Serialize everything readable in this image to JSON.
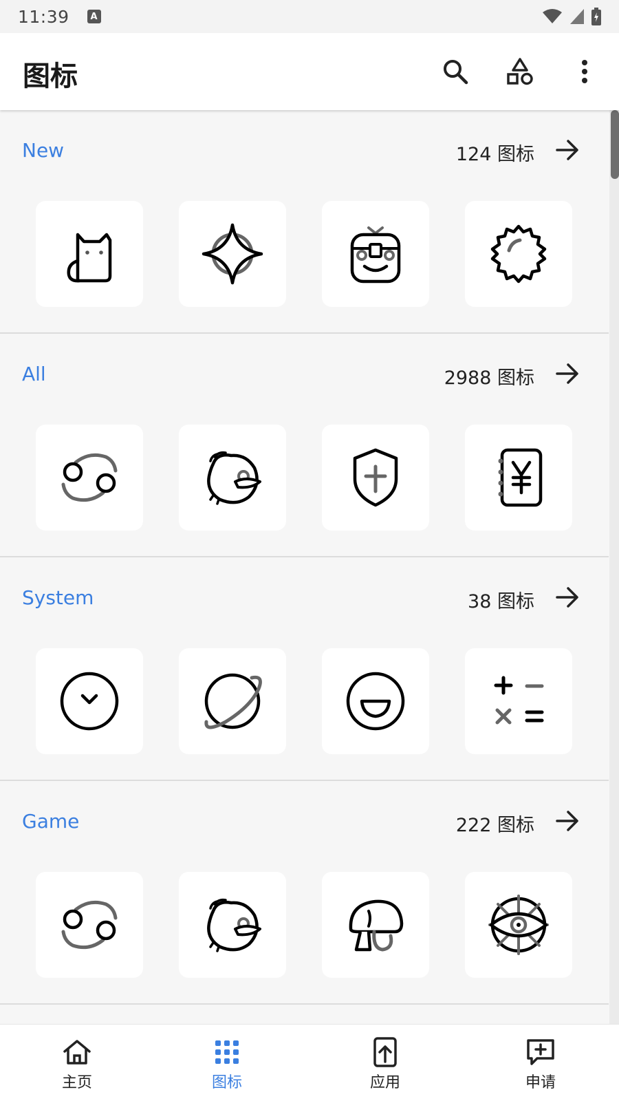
{
  "status_bar": {
    "time": "11:39",
    "badge": "A"
  },
  "app_bar": {
    "title": "图标",
    "actions": [
      "search-icon",
      "shapes-icon",
      "more-vert-icon"
    ]
  },
  "colors": {
    "accent": "#3b7fe0",
    "text": "#1f1f1f",
    "card": "#ffffff",
    "background": "#f6f6f6"
  },
  "sections": [
    {
      "title": "New",
      "count": "124 图标",
      "icons": [
        "cat-icon",
        "sparkle-star-icon",
        "robot-face-icon",
        "gear-sun-icon"
      ]
    },
    {
      "title": "All",
      "count": "2988 图标",
      "icons": [
        "cancer-zodiac-icon",
        "bird-icon",
        "shield-plus-icon",
        "yen-notebook-icon"
      ]
    },
    {
      "title": "System",
      "count": "38 图标",
      "icons": [
        "clock-chevron-icon",
        "planet-icon",
        "smile-face-icon",
        "calculator-icon"
      ]
    },
    {
      "title": "Game",
      "count": "222 图标",
      "icons": [
        "cancer-zodiac-icon",
        "bird-icon",
        "mushroom-icon",
        "eye-wheel-icon"
      ]
    }
  ],
  "bottom_nav": [
    {
      "label": "主页",
      "icon": "home-icon",
      "active": false
    },
    {
      "label": "图标",
      "icon": "grid-icon",
      "active": true
    },
    {
      "label": "应用",
      "icon": "app-upload-icon",
      "active": false
    },
    {
      "label": "申请",
      "icon": "request-icon",
      "active": false
    }
  ]
}
